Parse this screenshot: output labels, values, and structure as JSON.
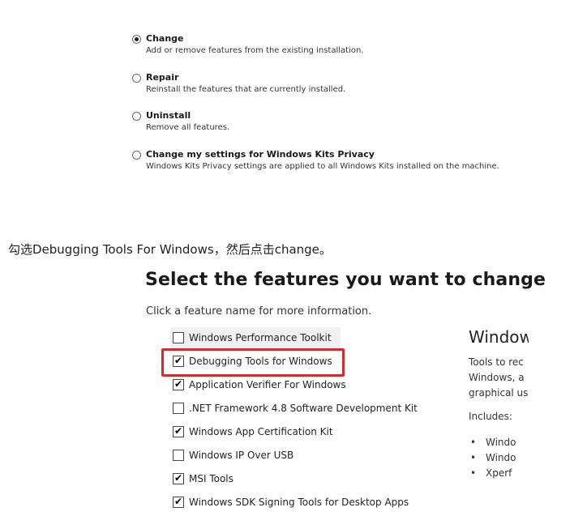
{
  "installer_options": [
    {
      "title": "Change",
      "description": "Add or remove features from the existing installation.",
      "selected": true
    },
    {
      "title": "Repair",
      "description": "Reinstall the features that are currently installed.",
      "selected": false
    },
    {
      "title": "Uninstall",
      "description": "Remove all features.",
      "selected": false
    },
    {
      "title": "Change my settings for Windows Kits Privacy",
      "description": "Windows Kits Privacy settings are applied to all Windows Kits installed on the machine.",
      "selected": false
    }
  ],
  "caption": "勾选Debugging Tools For Windows，然后点击change。",
  "feature_screen": {
    "heading": "Select the features you want to change",
    "subtitle": "Click a feature name for more information.",
    "features": [
      {
        "label": "Windows Performance Toolkit",
        "checked": false
      },
      {
        "label": "Debugging Tools for Windows",
        "checked": true
      },
      {
        "label": "Application Verifier For Windows",
        "checked": true
      },
      {
        "label": ".NET Framework 4.8 Software Development Kit",
        "checked": false
      },
      {
        "label": "Windows App Certification Kit",
        "checked": true
      },
      {
        "label": "Windows IP Over USB",
        "checked": false
      },
      {
        "label": "MSI Tools",
        "checked": true
      },
      {
        "label": "Windows SDK Signing Tools for Desktop Apps",
        "checked": true
      }
    ],
    "highlight_color": "#e0252b",
    "description_pane": {
      "title": "Window",
      "lines": [
        "Tools to rec",
        "Windows, a",
        "graphical us"
      ],
      "includes_label": "Includes:",
      "bullets": [
        "Windo",
        "Windo",
        "Xperf"
      ]
    }
  }
}
